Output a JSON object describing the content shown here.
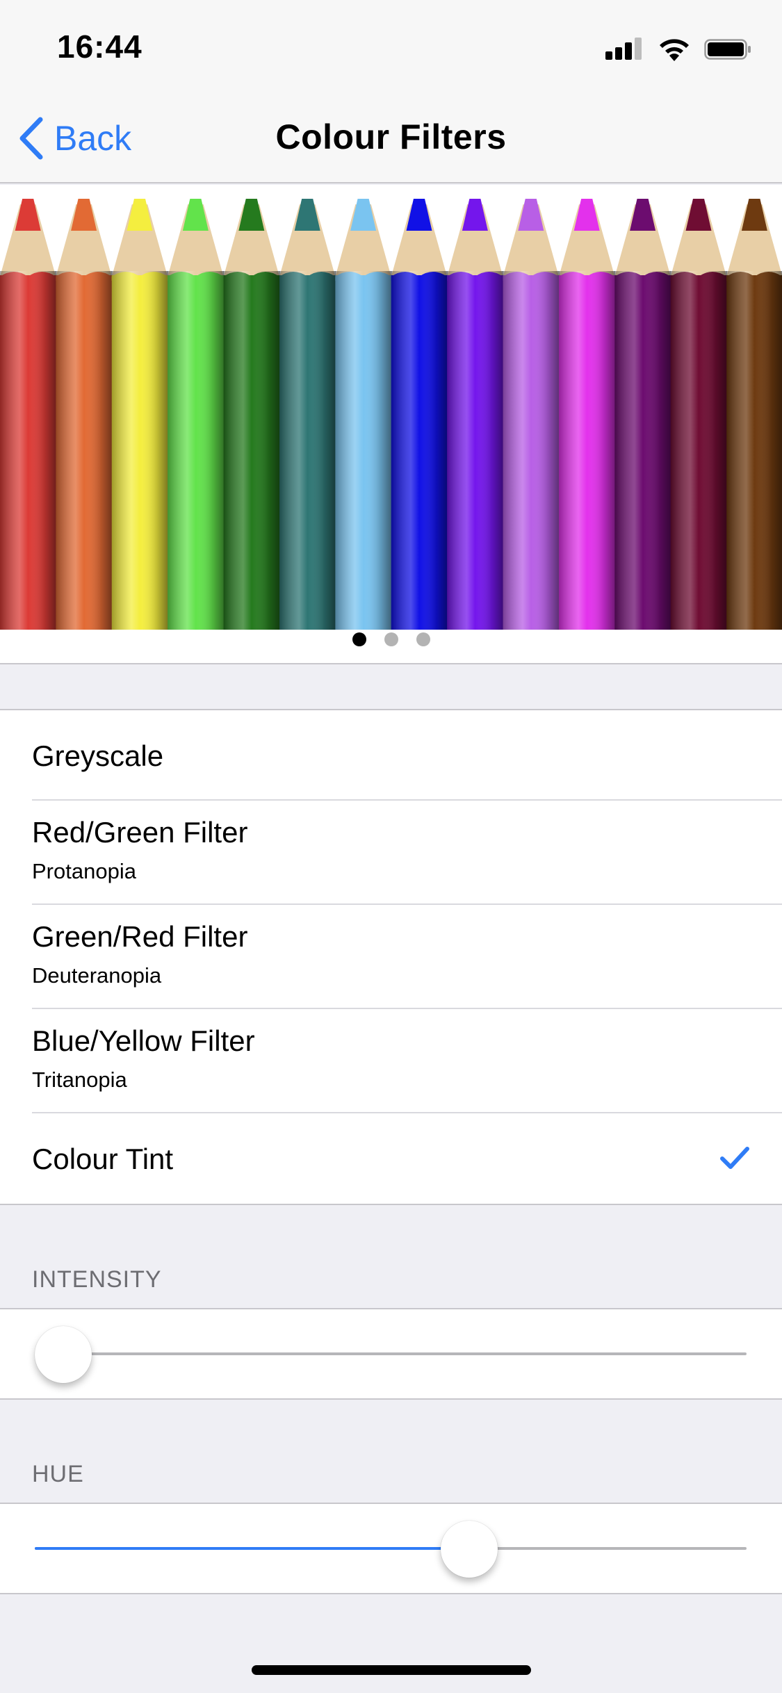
{
  "status_bar": {
    "time": "16:44"
  },
  "nav": {
    "back_label": "Back",
    "title": "Colour Filters"
  },
  "colors": {
    "accent": "#2f7cf6"
  },
  "preview": {
    "pencil_colors": [
      "#dc3b36",
      "#e26a34",
      "#f4ee3f",
      "#62e34b",
      "#257a1e",
      "#2e7674",
      "#7ac4f0",
      "#1111e6",
      "#7416ec",
      "#b85fe6",
      "#e331ec",
      "#6c0c6f",
      "#6f0d33",
      "#6e3a10"
    ],
    "page_count": 3,
    "current_page": 1
  },
  "filters": [
    {
      "title": "Greyscale",
      "subtitle": "",
      "selected": false
    },
    {
      "title": "Red/Green Filter",
      "subtitle": "Protanopia",
      "selected": false
    },
    {
      "title": "Green/Red Filter",
      "subtitle": "Deuteranopia",
      "selected": false
    },
    {
      "title": "Blue/Yellow Filter",
      "subtitle": "Tritanopia",
      "selected": false
    },
    {
      "title": "Colour Tint",
      "subtitle": "",
      "selected": true
    }
  ],
  "intensity": {
    "header": "INTENSITY",
    "value": 0.0
  },
  "hue": {
    "header": "HUE",
    "value": 0.61
  }
}
